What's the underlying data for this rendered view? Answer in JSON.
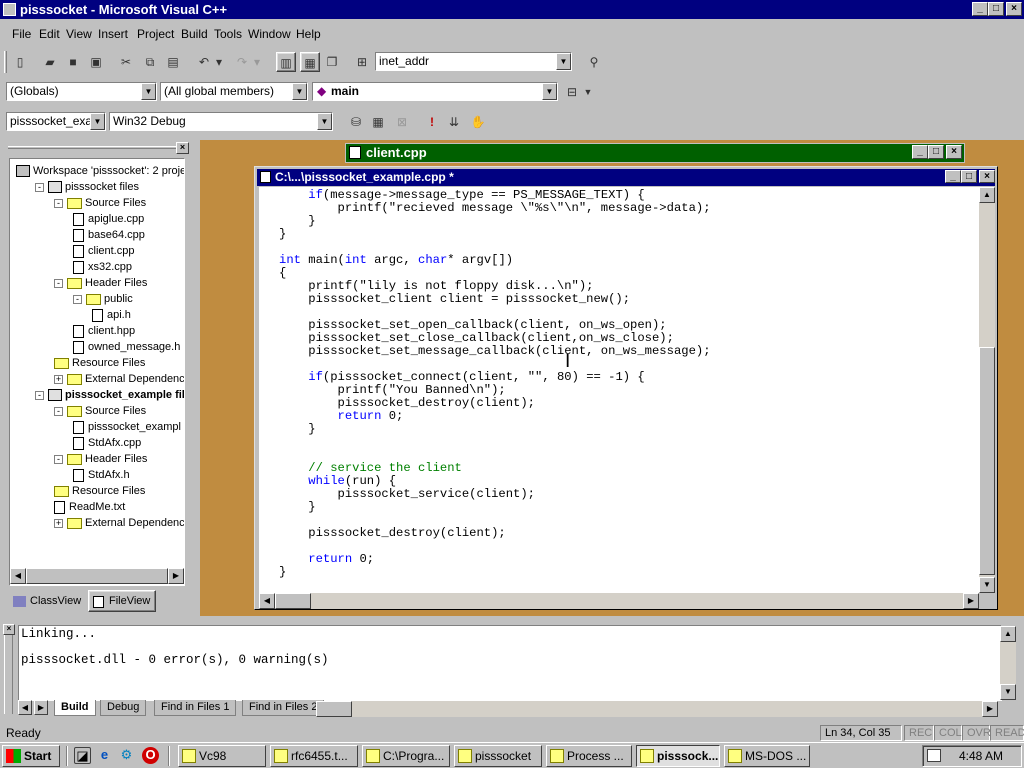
{
  "window": {
    "title": "pisssocket - Microsoft Visual C++"
  },
  "menu": [
    "File",
    "Edit",
    "View",
    "Insert",
    "Project",
    "Build",
    "Tools",
    "Window",
    "Help"
  ],
  "toolbar": {
    "find_combo": "inet_addr"
  },
  "wizardbar": {
    "class_combo": "(Globals)",
    "members_combo": "(All global members)",
    "function_combo": "main"
  },
  "buildbar": {
    "project_combo": "pisssocket_exan",
    "config_combo": "Win32 Debug"
  },
  "workspace": {
    "tree": [
      {
        "label": "Workspace 'pisssocket': 2 proje",
        "level": 0,
        "type": "workspace",
        "expander": ""
      },
      {
        "label": "pisssocket files",
        "level": 1,
        "type": "project",
        "expander": "-"
      },
      {
        "label": "Source Files",
        "level": 2,
        "type": "folder",
        "expander": "-"
      },
      {
        "label": "apiglue.cpp",
        "level": 3,
        "type": "file",
        "expander": ""
      },
      {
        "label": "base64.cpp",
        "level": 3,
        "type": "file",
        "expander": ""
      },
      {
        "label": "client.cpp",
        "level": 3,
        "type": "file",
        "expander": ""
      },
      {
        "label": "xs32.cpp",
        "level": 3,
        "type": "file",
        "expander": ""
      },
      {
        "label": "Header Files",
        "level": 2,
        "type": "folder",
        "expander": "-"
      },
      {
        "label": "public",
        "level": 3,
        "type": "folder",
        "expander": "-"
      },
      {
        "label": "api.h",
        "level": 4,
        "type": "file",
        "expander": ""
      },
      {
        "label": "client.hpp",
        "level": 3,
        "type": "file",
        "expander": ""
      },
      {
        "label": "owned_message.h",
        "level": 3,
        "type": "file",
        "expander": ""
      },
      {
        "label": "Resource Files",
        "level": 2,
        "type": "folder",
        "expander": ""
      },
      {
        "label": "External Dependencies",
        "level": 2,
        "type": "folder",
        "expander": "+"
      },
      {
        "label": "pisssocket_example fil",
        "level": 1,
        "type": "project-bold",
        "expander": "-"
      },
      {
        "label": "Source Files",
        "level": 2,
        "type": "folder",
        "expander": "-"
      },
      {
        "label": "pisssocket_exampl",
        "level": 3,
        "type": "file",
        "expander": ""
      },
      {
        "label": "StdAfx.cpp",
        "level": 3,
        "type": "file",
        "expander": ""
      },
      {
        "label": "Header Files",
        "level": 2,
        "type": "folder",
        "expander": "-"
      },
      {
        "label": "StdAfx.h",
        "level": 3,
        "type": "file",
        "expander": ""
      },
      {
        "label": "Resource Files",
        "level": 2,
        "type": "folder",
        "expander": ""
      },
      {
        "label": "ReadMe.txt",
        "level": 2,
        "type": "file",
        "expander": ""
      },
      {
        "label": "External Dependencies",
        "level": 2,
        "type": "folder",
        "expander": "+"
      }
    ],
    "tabs": [
      "ClassView",
      "FileView"
    ]
  },
  "client_window": {
    "title": "client.cpp"
  },
  "editor": {
    "title": "C:\\...\\pisssocket_example.cpp *",
    "code_lines": [
      "    if(message->message_type == PS_MESSAGE_TEXT) {",
      "        printf(\"recieved message \\\"%s\\\"\\n\", message->data);",
      "    }",
      "}",
      "",
      "int main(int argc, char* argv[])",
      "{",
      "    printf(\"lily is not floppy disk...\\n\");",
      "    pisssocket_client client = pisssocket_new();",
      "",
      "    pisssocket_set_open_callback(client, on_ws_open);",
      "    pisssocket_set_close_callback(client,on_ws_close);",
      "    pisssocket_set_message_callback(client, on_ws_message);",
      "",
      "    if(pisssocket_connect(client, \"\", 80) == -1) {",
      "        printf(\"You Banned\\n\");",
      "        pisssocket_destroy(client);",
      "        return 0;",
      "    }",
      "",
      "",
      "    // service the client",
      "    while(run) {",
      "        pisssocket_service(client);",
      "    }",
      "",
      "    pisssocket_destroy(client);",
      "",
      "    return 0;",
      "}"
    ]
  },
  "output": {
    "lines": [
      "Linking...",
      "",
      "pisssocket.dll - 0 error(s), 0 warning(s)"
    ],
    "tabs": [
      "Build",
      "Debug",
      "Find in Files 1",
      "Find in Files 2"
    ]
  },
  "statusbar": {
    "text": "Ready",
    "position": "Ln 34, Col 35",
    "indicators": [
      "REC",
      "COL",
      "OVR",
      "READ"
    ]
  },
  "taskbar": {
    "start": "Start",
    "buttons": [
      "Vc98",
      "rfc6455.t...",
      "C:\\Progra...",
      "pisssocket",
      "Process ...",
      "pisssock...",
      "MS-DOS ..."
    ],
    "active_index": 5,
    "clock": "4:48 AM"
  }
}
